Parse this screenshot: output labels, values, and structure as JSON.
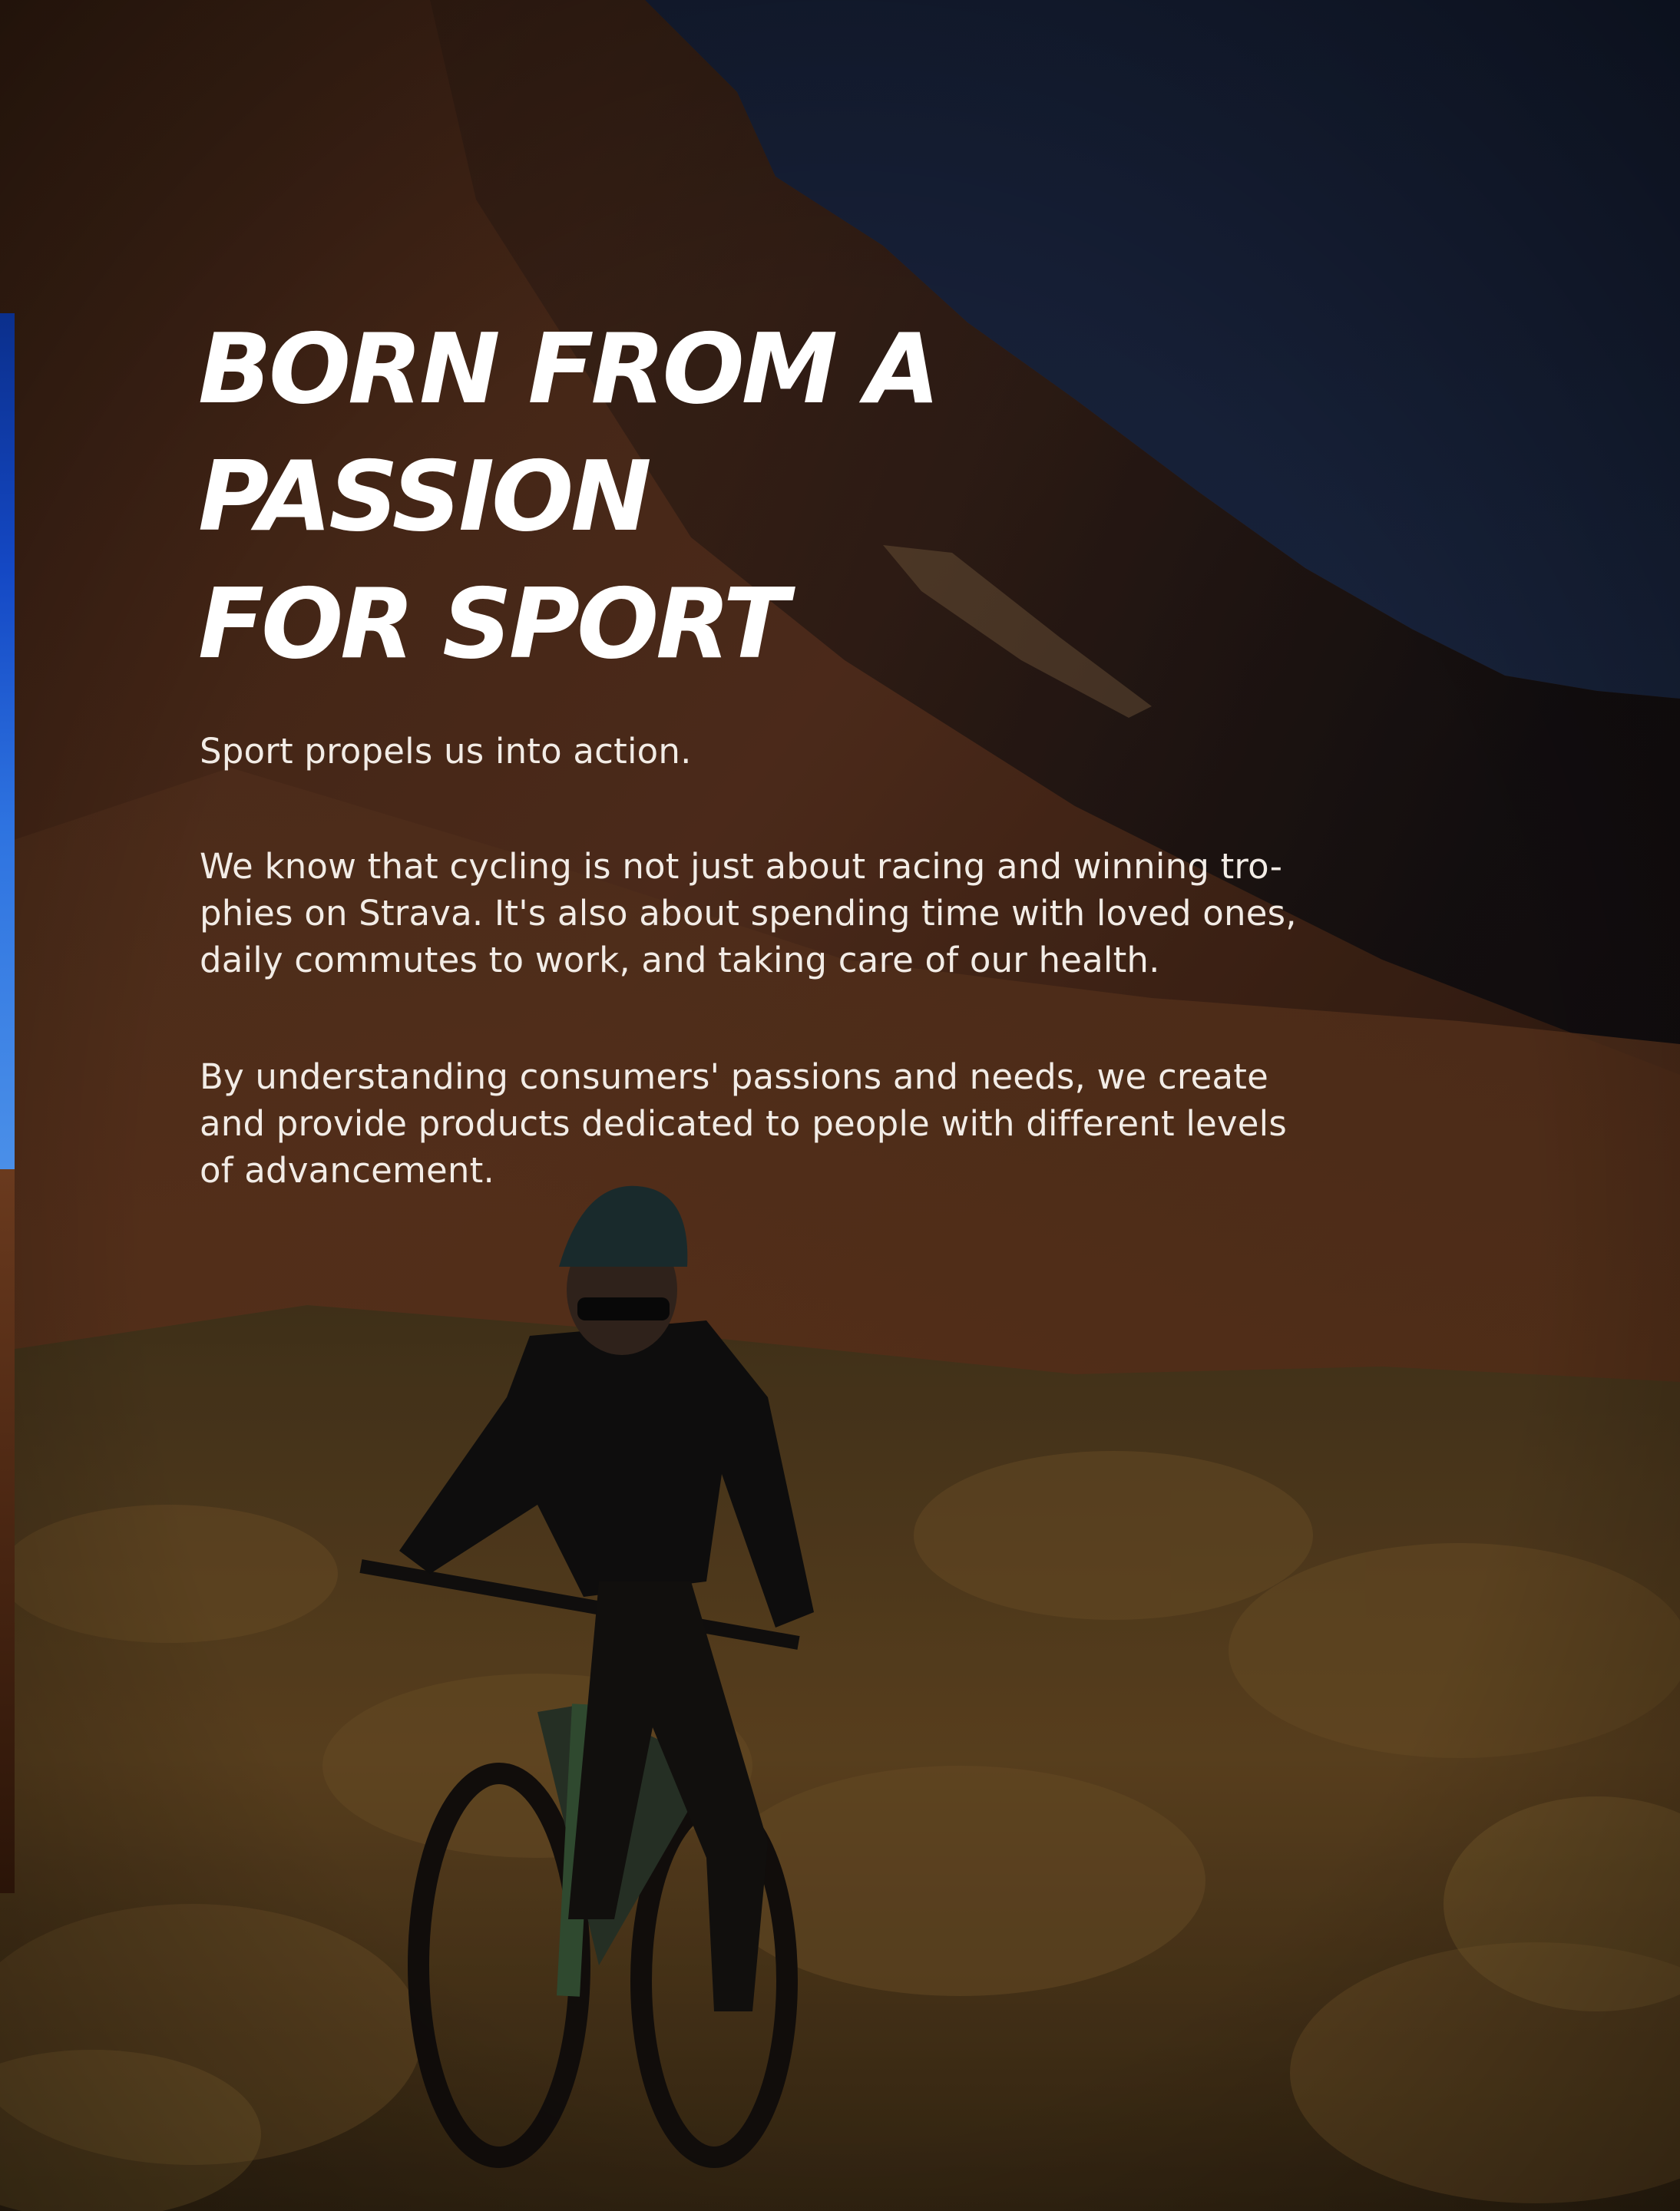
{
  "hero": {
    "headline_line_1": "BORN FROM A PASSION",
    "headline_line_2": "FOR SPORT"
  },
  "intro": {
    "paragraph_1": "Sport propels us into action.",
    "paragraph_2_lines": [
      "We know that cycling is not just about racing and winning tro-",
      "phies on Strava. It's also about spending time with loved ones,",
      "daily commutes to work, and taking care of our health."
    ],
    "paragraph_3_lines": [
      "By understanding consumers' passions and needs, we create",
      "and provide products dedicated to people with different levels",
      "of advancement."
    ]
  },
  "colors": {
    "text": "#ffffff",
    "accent_strip": "#1448c4",
    "sky": "#1d2a45",
    "rock": "#5a3420",
    "grass": "#6b4a22"
  },
  "background_image": "mountain-biker-desert-dusk-photo"
}
